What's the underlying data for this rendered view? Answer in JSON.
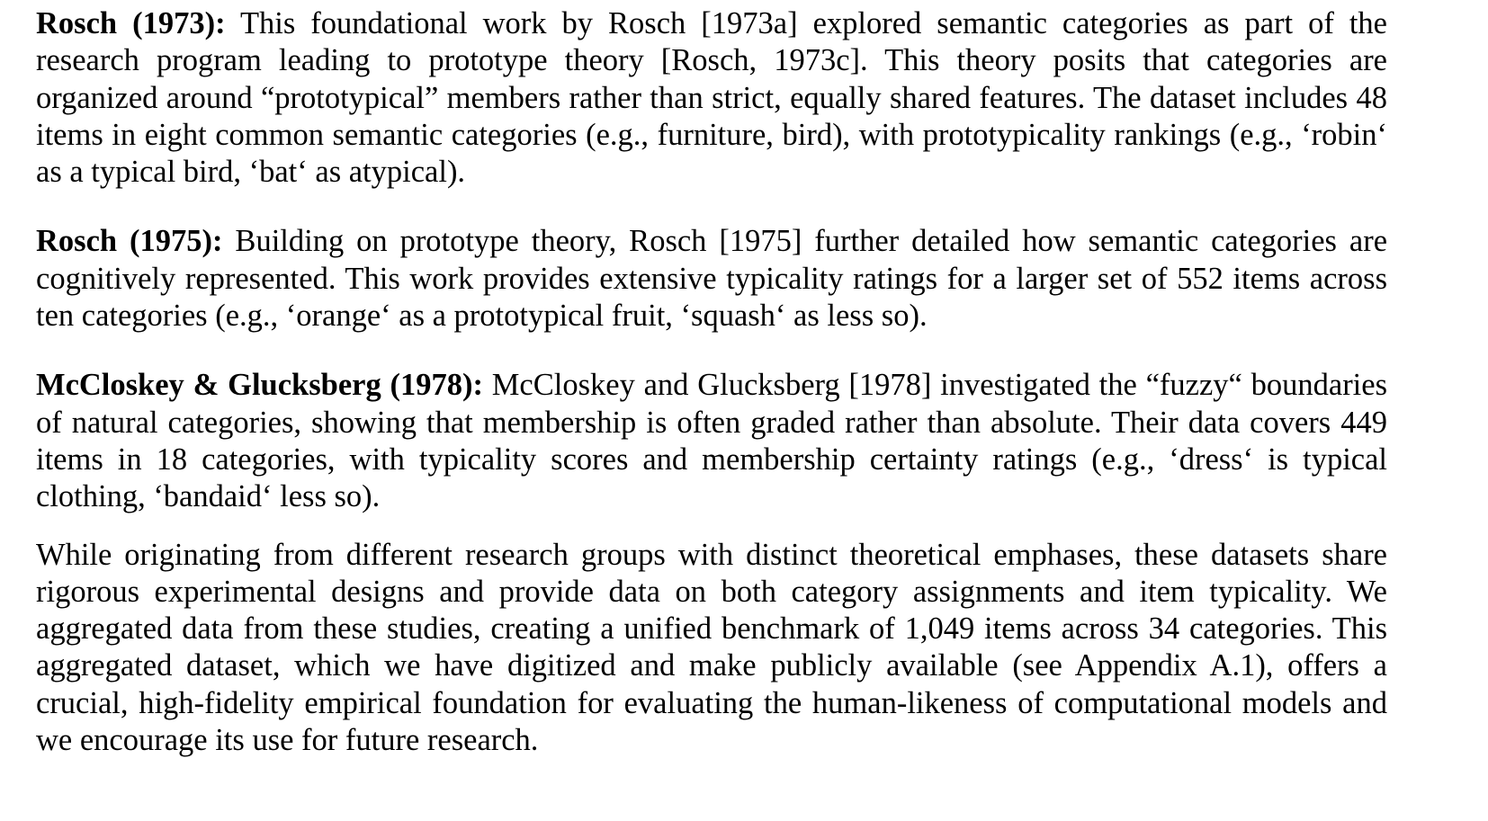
{
  "paragraphs": [
    {
      "lead": "Rosch (1973):",
      "text": " This foundational work by Rosch [1973a] explored semantic categories as part of the research program leading to prototype theory [Rosch, 1973c]. This theory posits that categories are organized around “prototypical” members rather than strict, equally shared features. The dataset includes 48 items in eight common semantic categories (e.g., furniture, bird), with prototypicality rankings (e.g., ‘robin‘ as a typical bird, ‘bat‘ as atypical)."
    },
    {
      "lead": "Rosch (1975):",
      "text": " Building on prototype theory, Rosch [1975] further detailed how semantic categories are cognitively represented. This work provides extensive typicality ratings for a larger set of 552 items across ten categories (e.g., ‘orange‘ as a prototypical fruit, ‘squash‘ as less so)."
    },
    {
      "lead": "McCloskey & Glucksberg (1978):",
      "text": " McCloskey and Glucksberg [1978] investigated the “fuzzy“ boundaries of natural categories, showing that membership is often graded rather than absolute. Their data covers 449 items in 18 categories, with typicality scores and membership certainty ratings (e.g., ‘dress‘ is typical clothing, ‘bandaid‘ less so)."
    },
    {
      "lead": "",
      "text": "While originating from different research groups with distinct theoretical emphases, these datasets share rigorous experimental designs and provide data on both category assignments and item typicality. We aggregated data from these studies, creating a unified benchmark of 1,049 items across 34 categories.  This aggregated dataset, which we have digitized and make publicly available (see Appendix A.1), offers a crucial, high-fidelity empirical foundation for evaluating the human-likeness of computational models and we encourage its use for future research."
    }
  ]
}
